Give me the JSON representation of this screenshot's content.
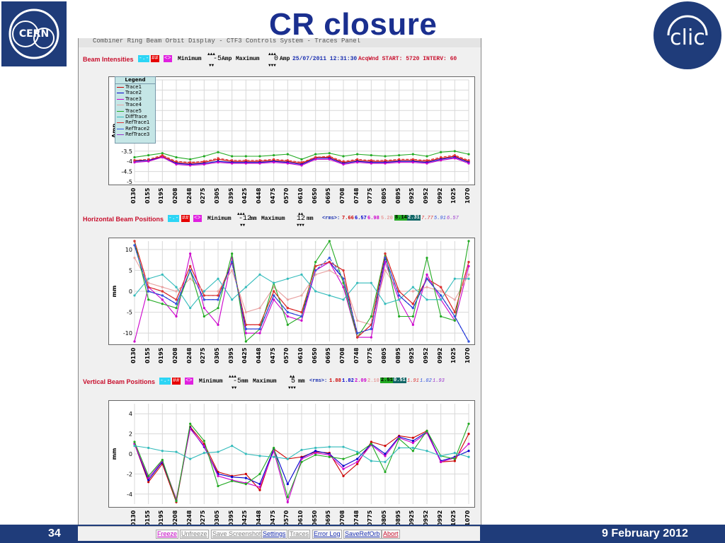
{
  "slide": {
    "title": "CR closure",
    "page_number": "34",
    "date": "9 February 2012",
    "logos": [
      "CERN",
      "clic"
    ]
  },
  "window": {
    "title_fragment": "Combiner Ring Beam Orbit Display - CTF3 Controls System - Traces Panel"
  },
  "panels": [
    {
      "id": "intensity",
      "title": "Beam Intensities",
      "buttons": [
        "-.-",
        "##",
        "<>"
      ],
      "min_label": "Minimum",
      "min_value": "-5",
      "max_label": "Maximum",
      "max_value": "0",
      "unit": "Amp",
      "info_date": "25/07/2011 12:31:30",
      "acq": "AcqWnd START: 5720 INTERV: 60"
    },
    {
      "id": "horizontal",
      "title": "Horizontal Beam Positions",
      "buttons": [
        "-.-",
        "##",
        "<>"
      ],
      "min_label": "Minimum",
      "min_value": "-12",
      "max_label": "Maximum",
      "max_value": "12",
      "unit": "mm",
      "rms_label": "<rms>:",
      "rms": [
        "7.66",
        "6.57",
        "6.98",
        "5.20",
        "8.14",
        "2.31",
        "7.77",
        "5.91",
        "6.57"
      ]
    },
    {
      "id": "vertical",
      "title": "Vertical Beam Positions",
      "buttons": [
        "-.-",
        "##",
        "<>"
      ],
      "min_label": "Minimum",
      "min_value": "-5",
      "max_label": "Maximum",
      "max_value": "5",
      "unit": "mm",
      "rms_label": "<rms>:",
      "rms": [
        "1.88",
        "1.82",
        "2.09",
        "2.10",
        "2.51",
        "0.51",
        "1.91",
        "1.82",
        "1.93"
      ]
    }
  ],
  "legend": {
    "title": "Legend",
    "items": [
      "Trace1",
      "Trace2",
      "Trace3",
      "Trace4",
      "Trace5",
      "DiffTrace",
      "RefTrace1",
      "RefTrace2",
      "RefTrace3"
    ]
  },
  "toolbar": [
    "Freeze",
    "Unfreeze",
    "Save Screenshot",
    "Settings",
    "Traces",
    "Error Log",
    "SaveRefOrb",
    "Abort"
  ],
  "colors": {
    "trace1": "#cc0000",
    "trace2": "#0000cc",
    "trace3": "#cc00cc",
    "trace4": "#e8a0a0",
    "trace5": "#22aa22",
    "difftrace": "#33bbbb",
    "reftrace1": "#dd3333",
    "reftrace2": "#3355dd",
    "reftrace3": "#9933cc",
    "slide_blue": "#1f3c7a",
    "title_blue": "#1a2f8f"
  },
  "chart_data": [
    {
      "type": "line",
      "title": "Beam Intensities",
      "ylabel": "Amp",
      "ylim": [
        -5,
        0
      ],
      "yticks": [
        0,
        -0.5,
        -1,
        -1.5,
        -2,
        -2.5,
        -3,
        -3.5,
        -4,
        -4.5,
        -5
      ],
      "grid": true,
      "legend": "top-left",
      "categories": [
        "0130",
        "0155",
        "0195",
        "0208",
        "0248",
        "0275",
        "0305",
        "0395",
        "0425",
        "0448",
        "0475",
        "0570",
        "0610",
        "0650",
        "0695",
        "0708",
        "0748",
        "0775",
        "0805",
        "0895",
        "0925",
        "0952",
        "0992",
        "1025",
        "1070"
      ],
      "series": [
        {
          "name": "Trace1",
          "values": [
            -3.95,
            -3.95,
            -3.75,
            -4.05,
            -4.1,
            -4.05,
            -3.9,
            -4.0,
            -4.0,
            -4.0,
            -3.95,
            -4.0,
            -4.1,
            -3.8,
            -3.8,
            -4.05,
            -3.95,
            -4.0,
            -4.0,
            -3.95,
            -3.95,
            -4.0,
            -3.85,
            -3.75,
            -4.0
          ]
        },
        {
          "name": "Trace2",
          "values": [
            -4.0,
            -3.95,
            -3.8,
            -4.1,
            -4.15,
            -4.1,
            -4.0,
            -4.05,
            -4.05,
            -4.05,
            -4.0,
            -4.05,
            -4.15,
            -3.85,
            -3.85,
            -4.1,
            -4.0,
            -4.05,
            -4.05,
            -4.0,
            -4.0,
            -4.05,
            -3.9,
            -3.8,
            -4.05
          ]
        },
        {
          "name": "Trace3",
          "values": [
            -4.05,
            -4.0,
            -3.8,
            -4.15,
            -4.2,
            -4.15,
            -4.05,
            -4.1,
            -4.1,
            -4.1,
            -4.05,
            -4.1,
            -4.2,
            -3.9,
            -3.9,
            -4.15,
            -4.05,
            -4.1,
            -4.1,
            -4.05,
            -4.05,
            -4.1,
            -3.95,
            -3.85,
            -4.1
          ]
        },
        {
          "name": "Trace5",
          "values": [
            -3.8,
            -3.7,
            -3.6,
            -3.8,
            -3.9,
            -3.75,
            -3.55,
            -3.75,
            -3.75,
            -3.75,
            -3.7,
            -3.65,
            -3.9,
            -3.65,
            -3.6,
            -3.75,
            -3.65,
            -3.7,
            -3.75,
            -3.7,
            -3.65,
            -3.75,
            -3.55,
            -3.5,
            -3.65
          ]
        },
        {
          "name": "RefTrace1",
          "values": [
            -3.95,
            -3.9,
            -3.7,
            -4.0,
            -4.05,
            -4.0,
            -3.85,
            -3.95,
            -3.95,
            -3.95,
            -3.9,
            -3.95,
            -4.05,
            -3.8,
            -3.75,
            -4.0,
            -3.9,
            -3.95,
            -3.95,
            -3.9,
            -3.9,
            -3.95,
            -3.8,
            -3.7,
            -3.95
          ]
        }
      ]
    },
    {
      "type": "line",
      "title": "Horizontal Beam Positions",
      "ylabel": "mm",
      "ylim": [
        -12,
        12
      ],
      "yticks": [
        10,
        5,
        0,
        -5,
        -10
      ],
      "grid": true,
      "categories": [
        "0130",
        "0155",
        "0195",
        "0208",
        "0248",
        "0275",
        "0305",
        "0395",
        "0425",
        "0448",
        "0475",
        "0570",
        "0610",
        "0650",
        "0695",
        "0708",
        "0748",
        "0775",
        "0805",
        "0895",
        "0925",
        "0952",
        "0992",
        "1025",
        "1070"
      ],
      "series": [
        {
          "name": "Trace1",
          "values": [
            12,
            1,
            0,
            -2,
            6,
            -1,
            -1,
            7,
            -8,
            -8,
            0,
            -4,
            -5,
            6,
            7,
            5,
            -11,
            -8,
            9,
            0,
            -3,
            3,
            1,
            -5,
            7
          ]
        },
        {
          "name": "Trace2",
          "values": [
            11,
            0,
            -1,
            -3,
            5,
            -2,
            -2,
            7,
            -9,
            -9,
            -1,
            -5,
            -6,
            5,
            7,
            3,
            -10,
            -9,
            8,
            -1,
            -4,
            3,
            -1,
            -6,
            -12
          ]
        },
        {
          "name": "Trace3",
          "values": [
            -12,
            1,
            -2,
            -6,
            9,
            -4,
            -8,
            8,
            -10,
            -10,
            -2,
            -6,
            -7,
            5,
            7,
            1,
            -11,
            -11,
            7,
            -2,
            -8,
            4,
            -2,
            -7,
            6
          ]
        },
        {
          "name": "Trace4",
          "values": [
            8,
            2,
            1,
            0,
            3,
            0,
            0,
            5,
            -5,
            -4,
            1,
            -2,
            -1,
            4,
            5,
            3,
            -7,
            -8,
            5,
            0,
            0,
            1,
            0,
            -2,
            4
          ]
        },
        {
          "name": "Trace5",
          "values": [
            12,
            -2,
            -3,
            -4,
            5,
            -6,
            -4,
            9,
            -12,
            -9,
            2,
            -8,
            -6,
            7,
            12,
            2,
            -11,
            -6,
            9,
            -6,
            -6,
            8,
            -6,
            -7,
            12
          ]
        },
        {
          "name": "DiffTrace",
          "values": [
            -1,
            3,
            4,
            1,
            -4,
            0,
            3,
            -2,
            1,
            4,
            2,
            3,
            4,
            0,
            -1,
            -2,
            2,
            2,
            -3,
            -2,
            1,
            -2,
            -2,
            3,
            3
          ]
        },
        {
          "name": "RefTrace1",
          "values": [
            12,
            1,
            0,
            -2,
            6,
            -1,
            -1,
            7,
            -8,
            -8,
            0,
            -4,
            -5,
            6,
            7,
            5,
            -11,
            -8,
            9,
            0,
            -3,
            3,
            1,
            -5,
            7
          ]
        },
        {
          "name": "RefTrace2",
          "values": [
            11,
            0,
            -1,
            -3,
            5,
            -2,
            -2,
            7,
            -9,
            -9,
            -1,
            -5,
            -6,
            5,
            8,
            3,
            -10,
            -9,
            8,
            -1,
            -4,
            3,
            -1,
            -6,
            -12
          ]
        }
      ]
    },
    {
      "type": "line",
      "title": "Vertical Beam Positions",
      "ylabel": "mm",
      "ylim": [
        -5,
        5
      ],
      "yticks": [
        4,
        2,
        0,
        -2,
        -4
      ],
      "grid": true,
      "categories": [
        "0130",
        "0155",
        "0195",
        "0208",
        "0248",
        "0275",
        "0305",
        "0395",
        "0425",
        "0448",
        "0475",
        "0570",
        "0610",
        "0650",
        "0695",
        "0708",
        "0748",
        "0775",
        "0805",
        "0895",
        "0925",
        "0952",
        "0992",
        "1025",
        "1070"
      ],
      "series": [
        {
          "name": "Trace1",
          "values": [
            1,
            -2.8,
            -1,
            -4.8,
            2.7,
            1.0,
            -1.8,
            -2.2,
            -2.0,
            -3.6,
            0.5,
            -0.5,
            -0.3,
            0.2,
            0.1,
            -2.2,
            -1.0,
            1.2,
            0.8,
            1.8,
            1.6,
            2.3,
            -0.8,
            -0.7,
            2.0
          ]
        },
        {
          "name": "Trace2",
          "values": [
            1,
            -2.6,
            -0.8,
            -4.6,
            2.6,
            0.7,
            -2.0,
            -2.3,
            -2.4,
            -3.0,
            0.5,
            -3.0,
            -0.4,
            0.3,
            0.0,
            -1.2,
            -0.5,
            1.0,
            0.0,
            1.7,
            1.3,
            2.2,
            -0.7,
            -0.3,
            0.3
          ]
        },
        {
          "name": "Trace3",
          "values": [
            1,
            -2.4,
            -0.7,
            -4.5,
            2.5,
            0.8,
            -2.2,
            -2.6,
            -2.9,
            -3.3,
            0.3,
            -4.8,
            -0.5,
            0.1,
            -0.1,
            -1.5,
            -0.8,
            0.9,
            -0.2,
            1.6,
            1.1,
            2.1,
            -0.8,
            -0.4,
            1.0
          ]
        },
        {
          "name": "Trace5",
          "values": [
            1.2,
            -2.2,
            -0.6,
            -4.7,
            3.0,
            1.3,
            -3.2,
            -2.7,
            -3.0,
            -2.0,
            0.6,
            -4.3,
            -0.8,
            -0.1,
            -0.3,
            -0.5,
            0.0,
            1.0,
            -1.8,
            1.5,
            0.3,
            2.3,
            -0.2,
            -0.5,
            3.0
          ]
        },
        {
          "name": "DiffTrace",
          "values": [
            0.8,
            0.6,
            0.3,
            0.2,
            -0.5,
            0.1,
            0.2,
            0.8,
            0.0,
            -0.2,
            -0.3,
            -0.5,
            0.4,
            0.6,
            0.7,
            0.7,
            0.2,
            -0.7,
            -0.8,
            0.6,
            0.6,
            0.3,
            -0.2,
            0.1,
            -0.3
          ]
        }
      ]
    }
  ]
}
